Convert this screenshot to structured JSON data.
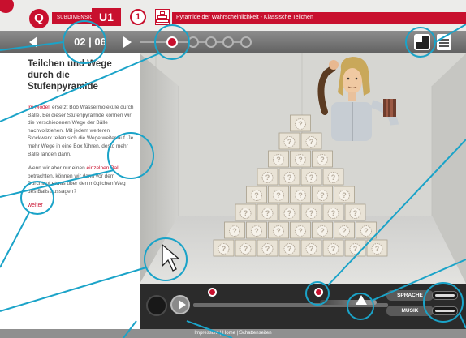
{
  "header": {
    "logo": "Q",
    "dimension_tag": "SUBDIMENSION",
    "unit": "U1",
    "unit_step": "1",
    "title": "Pyramide der Wahrscheinlichkeit - Klassische Teilchen"
  },
  "nav": {
    "page_counter": "02 | 06",
    "prev_icon": "arrow-left-icon",
    "next_icon": "arrow-right-icon",
    "steps": [
      {
        "active": true
      },
      {
        "active": false
      },
      {
        "active": false
      },
      {
        "active": false
      },
      {
        "active": false
      }
    ]
  },
  "panel": {
    "title": "Teilchen und Wege durch die Stufenpyramide",
    "p1_highlight": "Im Modell",
    "p1_text": " ersetzt Bob Wassermoleküle durch Bälle. Bei dieser Stufenpyramide können wir die verschiedenen Wege der Bälle nachvollziehen. Mit jedem weiteren Stockwerk teilen sich die Wege weiter auf. Je mehr Wege in eine Box führen, desto mehr Bälle landen darin.",
    "p2_start": "Wenn wir aber nur einen ",
    "p2_highlight": "einzelnen Ball",
    "p2_end": " betrachten, können wir dann vor dem Durchlauf etwas über den möglichen Weg des Balls aussagen?",
    "link": "weiter"
  },
  "scene": {
    "box_mark": "?"
  },
  "controls": {
    "sprache_label": "SPRACHE",
    "musik_label": "MUSIK"
  },
  "footer": {
    "text": "Impressum | Home | Schattenseiten"
  },
  "colors": {
    "accent": "#c8102e",
    "callout": "#1aa3c8"
  }
}
